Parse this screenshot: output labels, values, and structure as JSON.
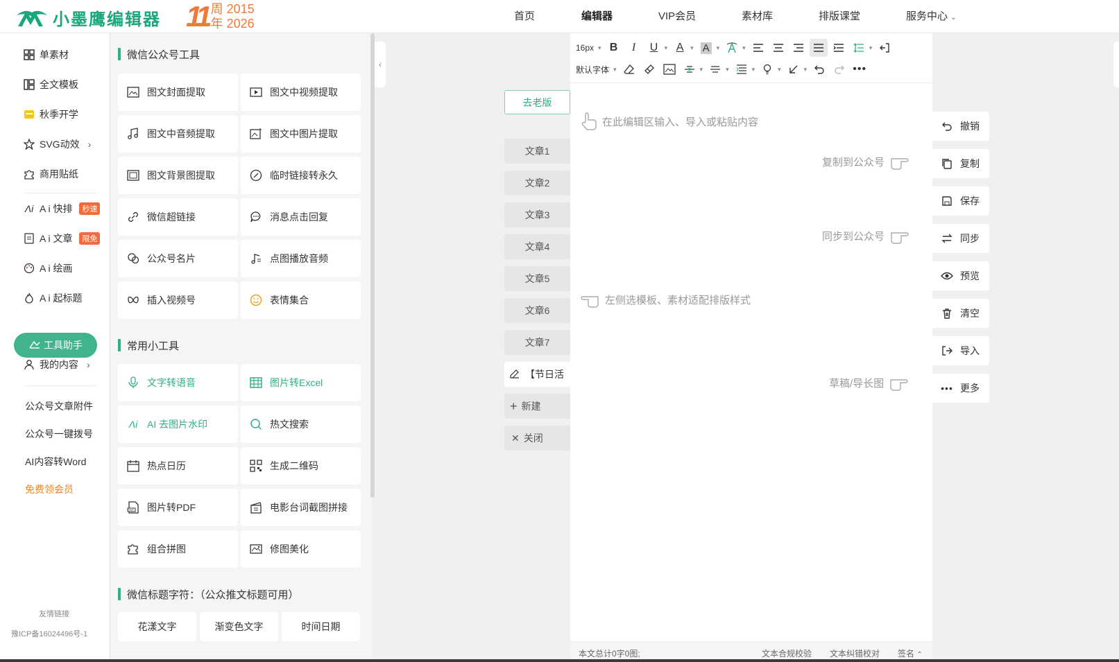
{
  "header": {
    "logo_text": "小墨鹰编辑器",
    "anniv_number": "11",
    "anniv_line1": "周",
    "anniv_year1": "2015",
    "anniv_line2": "年",
    "anniv_year2": "2026",
    "nav": [
      "首页",
      "编辑器",
      "VIP会员",
      "素材库",
      "排版课堂",
      "服务中心"
    ],
    "brand_color": "#1aa77c",
    "accent_color": "#f07a3a"
  },
  "sidebar": {
    "items": [
      {
        "label": "单素材",
        "icon": "grid-icon"
      },
      {
        "label": "全文模板",
        "icon": "template-icon"
      },
      {
        "label": "秋季开学",
        "icon": "calendar-badge-icon"
      },
      {
        "label": "SVG动效",
        "icon": "star-outline-icon",
        "arrow": "›"
      },
      {
        "label": "商用贴纸",
        "icon": "puzzle-icon"
      }
    ],
    "ai_items": [
      {
        "label": "A i 快排",
        "icon": "ai-icon",
        "badge": "秒速"
      },
      {
        "label": "A i 文章",
        "icon": "document-icon",
        "badge": "限免"
      },
      {
        "label": "A i 绘画",
        "icon": "palette-icon"
      },
      {
        "label": "A i 起标题",
        "icon": "fire-icon"
      }
    ],
    "tool_helper": "工具助手",
    "my_content": "我的内容",
    "my_content_arrow": "›",
    "links": [
      "公众号文章附件",
      "公众号一键拨号",
      "AI内容转Word"
    ],
    "vip_link": "免费领会员",
    "friend_links": "友情链接",
    "icp": "豫ICP备16024496号-1"
  },
  "tools": {
    "section1": "微信公众号工具",
    "section1_items": [
      {
        "label": "图文封面提取",
        "icon": "image-icon"
      },
      {
        "label": "图文中视频提取",
        "icon": "video-icon"
      },
      {
        "label": "图文中音频提取",
        "icon": "music-icon"
      },
      {
        "label": "图文中图片提取",
        "icon": "image-plus-icon"
      },
      {
        "label": "图文背景图提取",
        "icon": "background-image-icon"
      },
      {
        "label": "临时链接转永久",
        "icon": "link-convert-icon"
      },
      {
        "label": "微信超链接",
        "icon": "link-icon"
      },
      {
        "label": "消息点击回复",
        "icon": "chat-bubble-icon"
      },
      {
        "label": "公众号名片",
        "icon": "card-chat-icon"
      },
      {
        "label": "点图播放音频",
        "icon": "music-note-icon"
      },
      {
        "label": "插入视频号",
        "icon": "butterfly-icon"
      },
      {
        "label": "表情集合",
        "icon": "smiley-icon"
      }
    ],
    "section2": "常用小工具",
    "section2_items": [
      {
        "label": "文字转语音",
        "icon": "microphone-icon",
        "highlight": true
      },
      {
        "label": "图片转Excel",
        "icon": "table-icon",
        "highlight": true
      },
      {
        "label": "AI 去图片水印",
        "icon": "ai-icon",
        "highlight": true
      },
      {
        "label": "热文搜索",
        "icon": "search-icon"
      },
      {
        "label": "热点日历",
        "icon": "calendar-icon"
      },
      {
        "label": "生成二维码",
        "icon": "qrcode-icon"
      },
      {
        "label": "图片转PDF",
        "icon": "pdf-icon"
      },
      {
        "label": "电影台词截图拼接",
        "icon": "clapper-icon"
      },
      {
        "label": "组合拼图",
        "icon": "puzzle-icon"
      },
      {
        "label": "修图美化",
        "icon": "photo-edit-icon"
      }
    ],
    "section3": "微信标题字符：（公众推文标题可用）",
    "section3_items": [
      "花漾文字",
      "渐变色文字",
      "时间日期"
    ],
    "highlight_color": "#2fb082"
  },
  "articles": {
    "old_version": "去老版",
    "items": [
      "文章1",
      "文章2",
      "文章3",
      "文章4",
      "文章5",
      "文章6",
      "文章7"
    ],
    "active": "【节日活",
    "new": "新建",
    "close": "关闭"
  },
  "editor": {
    "font_size": "16px",
    "font_family": "默认字体",
    "hint_input": "在此编辑区输入、导入或粘贴内容",
    "hint_copy": "复制到公众号",
    "hint_sync": "同步到公众号",
    "hint_template": "左侧选模板、素材适配排版样式",
    "hint_draft": "草稿/导长图",
    "footer_count": "本文总计0字0图;",
    "footer_check": "文本合规校验",
    "footer_proof": "文本纠错校对",
    "footer_sign": "签名"
  },
  "actions": [
    {
      "label": "撤销",
      "icon": "undo-icon"
    },
    {
      "label": "复制",
      "icon": "copy-icon"
    },
    {
      "label": "保存",
      "icon": "save-icon"
    },
    {
      "label": "同步",
      "icon": "sync-icon"
    },
    {
      "label": "预览",
      "icon": "eye-icon"
    },
    {
      "label": "清空",
      "icon": "trash-icon"
    },
    {
      "label": "导入",
      "icon": "import-icon"
    },
    {
      "label": "更多",
      "icon": "more-icon"
    }
  ]
}
